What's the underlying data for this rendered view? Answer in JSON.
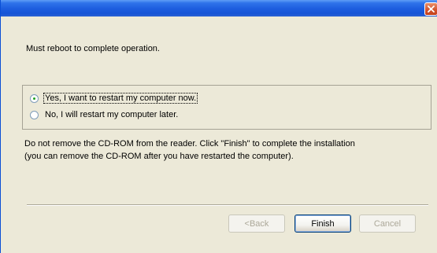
{
  "dialog": {
    "message": "Must reboot to complete operation.",
    "options": [
      {
        "label": "Yes, I want to restart my computer now.",
        "selected": true
      },
      {
        "label": "No, I will restart my computer later.",
        "selected": false
      }
    ],
    "info_line_1": "Do not remove the CD-ROM from the reader. Click \"Finish\" to complete the installation",
    "info_line_2": "(you can remove the CD-ROM after you have restarted the computer).",
    "buttons": {
      "back": "<Back",
      "finish": "Finish",
      "cancel": "Cancel"
    }
  },
  "titlebar": {
    "close_icon": "close-icon"
  },
  "colors": {
    "titlebar": "#1e5fe0",
    "close_button": "#d4552f",
    "dialog_bg": "#ece9d8",
    "radio_dot": "#21a121"
  }
}
